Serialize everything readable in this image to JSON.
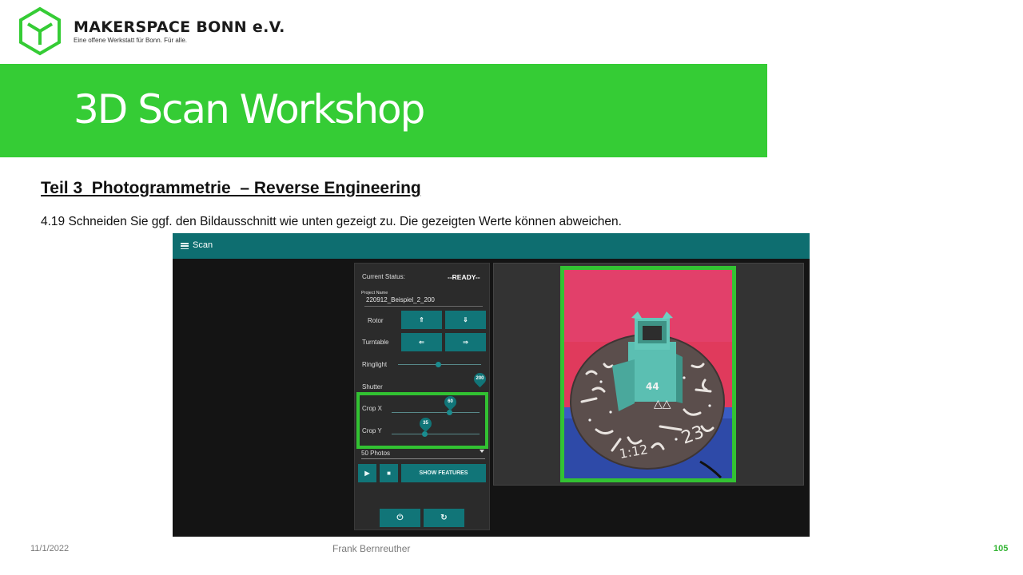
{
  "header": {
    "brand": "MAKERSPACE BONN e.V.",
    "tagline": "Eine offene Werkstatt für Bonn. Für alle.",
    "logo_icon": "hexagon-cube-logo-icon",
    "accent_color": "#35cc35"
  },
  "banner": {
    "title": "3D Scan Workshop"
  },
  "content": {
    "section_title": "Teil 3  Photogrammetrie  – Reverse Engineering",
    "instruction": "4.19 Schneiden Sie ggf. den Bildausschnitt wie unten gezeigt zu. Die gezeigten Werte können abweichen."
  },
  "app": {
    "title": "Scan",
    "menu_icon": "hamburger-menu-icon",
    "status_label": "Current Status:",
    "status_value": "--READY--",
    "project_name_label": "Project Name",
    "project_name_value": "220912_Beispiel_2_200",
    "rotor_label": "Rotor",
    "rotor_up": "⇑",
    "rotor_down": "⇓",
    "turntable_label": "Turntable",
    "turntable_left": "⇐",
    "turntable_right": "⇒",
    "ringlight_label": "Ringlight",
    "ringlight_level": 0.5,
    "shutter_label": "Shutter",
    "shutter_value": "200",
    "crop_x_label": "Crop X",
    "crop_x_value": "60",
    "crop_y_label": "Crop Y",
    "crop_y_value": "35",
    "photos_select": "50 Photos",
    "play_icon": "▶",
    "stop_icon": "■",
    "show_features_label": "SHOW FEATURES",
    "power_icon": "⏻",
    "refresh_icon": "↻",
    "highlight_color": "#32c232"
  },
  "footer": {
    "date": "11/1/2022",
    "author": "Frank Bernreuther",
    "page": "105"
  }
}
